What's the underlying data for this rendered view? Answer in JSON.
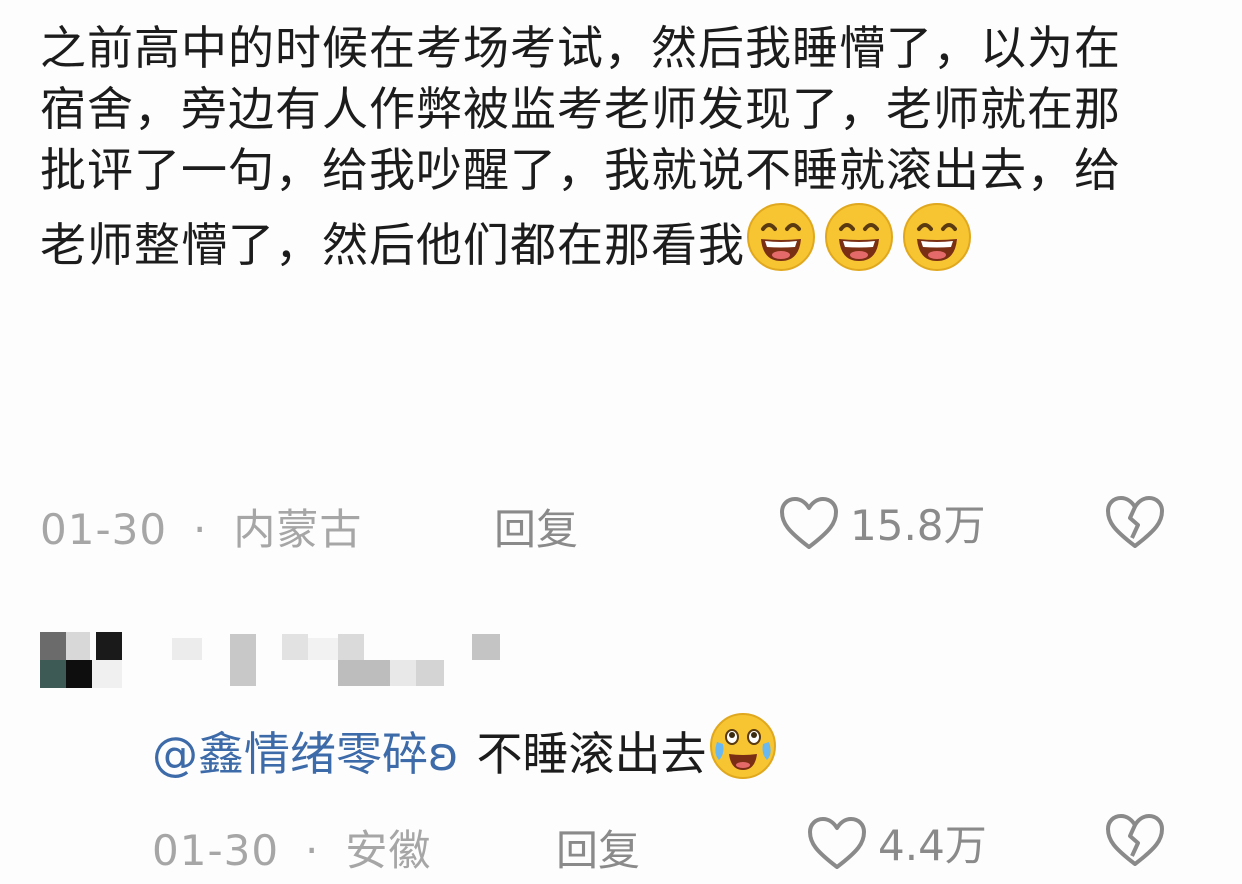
{
  "comment1": {
    "text": "之前高中的时候在考场考试，然后我睡懵了，以为在宿舍，旁边有人作弊被监考老师发现了，老师就在那批评了一句，给我吵醒了，我就说不睡就滚出去，给老师整懵了，然后他们都在那看我",
    "emojis": [
      "grin-emoji",
      "grin-emoji",
      "grin-emoji"
    ],
    "date": "01-30",
    "separator": "·",
    "location": "内蒙古",
    "reply_label": "回复",
    "likes": "15.8万"
  },
  "comment2": {
    "mention": "@鑫情绪零碎ʚ",
    "text": "不睡滚出去",
    "emoji": "laugh-cry-emoji",
    "date": "01-30",
    "separator": "·",
    "location": "安徽",
    "reply_label": "回复",
    "likes": "4.4万"
  },
  "colors": {
    "text": "#1c1c1c",
    "meta": "#a6a6a6",
    "mention": "#3d6aa8",
    "emoji_yellow": "#f7c531"
  }
}
